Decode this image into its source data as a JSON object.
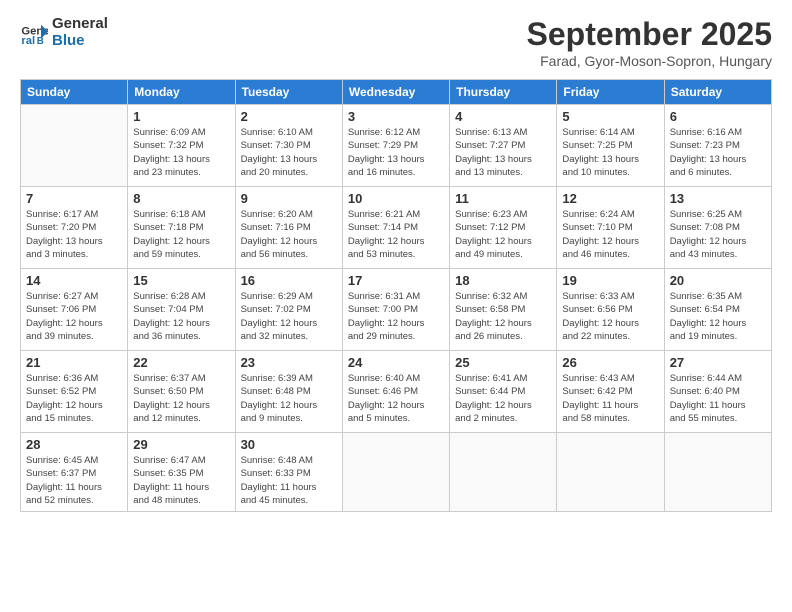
{
  "logo": {
    "line1": "General",
    "line2": "Blue"
  },
  "title": "September 2025",
  "subtitle": "Farad, Gyor-Moson-Sopron, Hungary",
  "weekdays": [
    "Sunday",
    "Monday",
    "Tuesday",
    "Wednesday",
    "Thursday",
    "Friday",
    "Saturday"
  ],
  "days": [
    {
      "num": "",
      "info": ""
    },
    {
      "num": "1",
      "info": "Sunrise: 6:09 AM\nSunset: 7:32 PM\nDaylight: 13 hours\nand 23 minutes."
    },
    {
      "num": "2",
      "info": "Sunrise: 6:10 AM\nSunset: 7:30 PM\nDaylight: 13 hours\nand 20 minutes."
    },
    {
      "num": "3",
      "info": "Sunrise: 6:12 AM\nSunset: 7:29 PM\nDaylight: 13 hours\nand 16 minutes."
    },
    {
      "num": "4",
      "info": "Sunrise: 6:13 AM\nSunset: 7:27 PM\nDaylight: 13 hours\nand 13 minutes."
    },
    {
      "num": "5",
      "info": "Sunrise: 6:14 AM\nSunset: 7:25 PM\nDaylight: 13 hours\nand 10 minutes."
    },
    {
      "num": "6",
      "info": "Sunrise: 6:16 AM\nSunset: 7:23 PM\nDaylight: 13 hours\nand 6 minutes."
    },
    {
      "num": "7",
      "info": "Sunrise: 6:17 AM\nSunset: 7:20 PM\nDaylight: 13 hours\nand 3 minutes."
    },
    {
      "num": "8",
      "info": "Sunrise: 6:18 AM\nSunset: 7:18 PM\nDaylight: 12 hours\nand 59 minutes."
    },
    {
      "num": "9",
      "info": "Sunrise: 6:20 AM\nSunset: 7:16 PM\nDaylight: 12 hours\nand 56 minutes."
    },
    {
      "num": "10",
      "info": "Sunrise: 6:21 AM\nSunset: 7:14 PM\nDaylight: 12 hours\nand 53 minutes."
    },
    {
      "num": "11",
      "info": "Sunrise: 6:23 AM\nSunset: 7:12 PM\nDaylight: 12 hours\nand 49 minutes."
    },
    {
      "num": "12",
      "info": "Sunrise: 6:24 AM\nSunset: 7:10 PM\nDaylight: 12 hours\nand 46 minutes."
    },
    {
      "num": "13",
      "info": "Sunrise: 6:25 AM\nSunset: 7:08 PM\nDaylight: 12 hours\nand 43 minutes."
    },
    {
      "num": "14",
      "info": "Sunrise: 6:27 AM\nSunset: 7:06 PM\nDaylight: 12 hours\nand 39 minutes."
    },
    {
      "num": "15",
      "info": "Sunrise: 6:28 AM\nSunset: 7:04 PM\nDaylight: 12 hours\nand 36 minutes."
    },
    {
      "num": "16",
      "info": "Sunrise: 6:29 AM\nSunset: 7:02 PM\nDaylight: 12 hours\nand 32 minutes."
    },
    {
      "num": "17",
      "info": "Sunrise: 6:31 AM\nSunset: 7:00 PM\nDaylight: 12 hours\nand 29 minutes."
    },
    {
      "num": "18",
      "info": "Sunrise: 6:32 AM\nSunset: 6:58 PM\nDaylight: 12 hours\nand 26 minutes."
    },
    {
      "num": "19",
      "info": "Sunrise: 6:33 AM\nSunset: 6:56 PM\nDaylight: 12 hours\nand 22 minutes."
    },
    {
      "num": "20",
      "info": "Sunrise: 6:35 AM\nSunset: 6:54 PM\nDaylight: 12 hours\nand 19 minutes."
    },
    {
      "num": "21",
      "info": "Sunrise: 6:36 AM\nSunset: 6:52 PM\nDaylight: 12 hours\nand 15 minutes."
    },
    {
      "num": "22",
      "info": "Sunrise: 6:37 AM\nSunset: 6:50 PM\nDaylight: 12 hours\nand 12 minutes."
    },
    {
      "num": "23",
      "info": "Sunrise: 6:39 AM\nSunset: 6:48 PM\nDaylight: 12 hours\nand 9 minutes."
    },
    {
      "num": "24",
      "info": "Sunrise: 6:40 AM\nSunset: 6:46 PM\nDaylight: 12 hours\nand 5 minutes."
    },
    {
      "num": "25",
      "info": "Sunrise: 6:41 AM\nSunset: 6:44 PM\nDaylight: 12 hours\nand 2 minutes."
    },
    {
      "num": "26",
      "info": "Sunrise: 6:43 AM\nSunset: 6:42 PM\nDaylight: 11 hours\nand 58 minutes."
    },
    {
      "num": "27",
      "info": "Sunrise: 6:44 AM\nSunset: 6:40 PM\nDaylight: 11 hours\nand 55 minutes."
    },
    {
      "num": "28",
      "info": "Sunrise: 6:45 AM\nSunset: 6:37 PM\nDaylight: 11 hours\nand 52 minutes."
    },
    {
      "num": "29",
      "info": "Sunrise: 6:47 AM\nSunset: 6:35 PM\nDaylight: 11 hours\nand 48 minutes."
    },
    {
      "num": "30",
      "info": "Sunrise: 6:48 AM\nSunset: 6:33 PM\nDaylight: 11 hours\nand 45 minutes."
    },
    {
      "num": "",
      "info": ""
    },
    {
      "num": "",
      "info": ""
    },
    {
      "num": "",
      "info": ""
    },
    {
      "num": "",
      "info": ""
    }
  ]
}
